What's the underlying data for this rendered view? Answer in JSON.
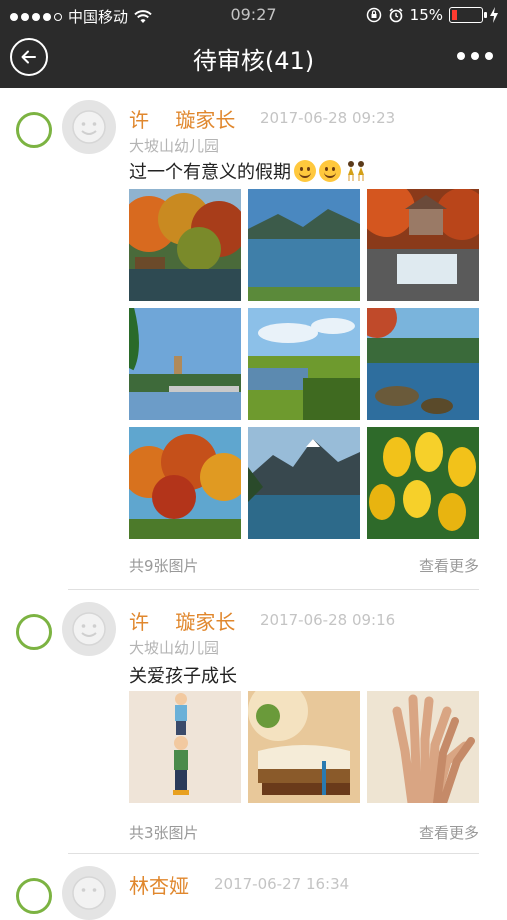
{
  "status_bar": {
    "carrier": "中国移动",
    "time": "09:27",
    "battery": "15%",
    "icons": [
      "signal-dots-icon",
      "wifi-icon",
      "rotation-lock-icon",
      "alarm-icon",
      "battery-icon",
      "charging-icon"
    ]
  },
  "header": {
    "title": "待审核(41)",
    "back_icon": "back-arrow-circle-icon",
    "more_icon": "more-dots-icon"
  },
  "colors": {
    "header_bg": "#2b2b2b",
    "radio_green": "#7cb342",
    "name_orange": "#e0872d",
    "battery_red": "#ff3b30"
  },
  "posts": [
    {
      "author": "许　 璇家长",
      "time": "2017-06-28 09:23",
      "school": "大坡山幼儿园",
      "text": "过一个有意义的假期",
      "emojis": [
        "smiling-face-icon",
        "smiling-face-icon",
        "dancers-icon"
      ],
      "photos": [
        "autumn-lake-photo",
        "mountain-lake-photo",
        "waterfall-mill-photo",
        "pagoda-lake-photo",
        "green-meadow-photo",
        "lake-rocks-photo",
        "autumn-forest-photo",
        "mountain-valley-lake-photo",
        "yellow-tulips-photo"
      ],
      "count": "共9张图片",
      "see_more": "查看更多"
    },
    {
      "author": "许　 璇家长",
      "time": "2017-06-28 09:16",
      "school": "大坡山幼儿园",
      "text": "关爱孩子成长",
      "photos": [
        "stacked-kids-photo",
        "books-photo",
        "hands-photo"
      ],
      "count": "共3张图片",
      "see_more": "查看更多"
    },
    {
      "author": "林杏娅",
      "time": "2017-06-27 16:34"
    }
  ]
}
